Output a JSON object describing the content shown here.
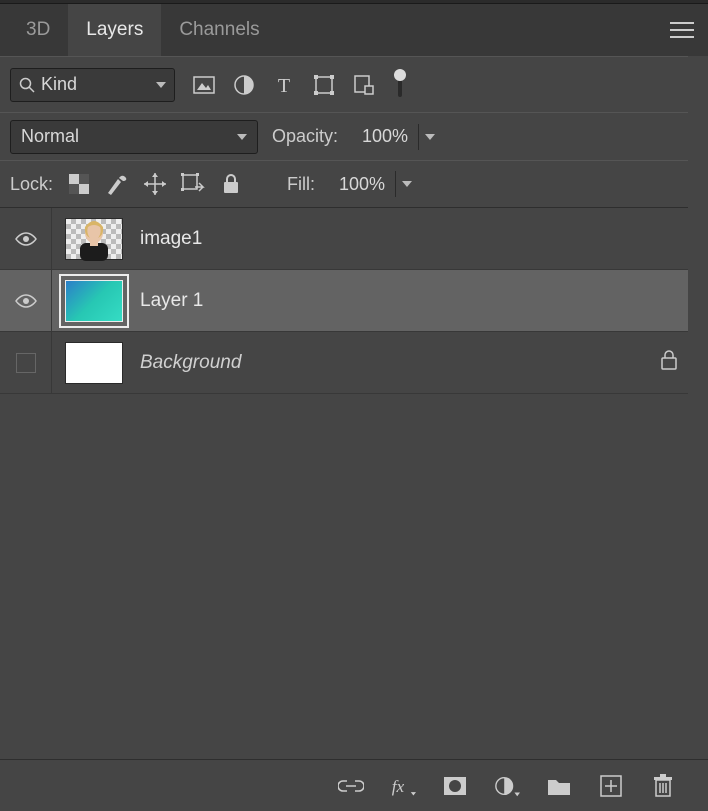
{
  "tabs": {
    "items": [
      {
        "label": "3D"
      },
      {
        "label": "Layers"
      },
      {
        "label": "Channels"
      }
    ],
    "active_index": 1
  },
  "filter": {
    "kind_label": "Kind"
  },
  "blend": {
    "mode": "Normal",
    "opacity_label": "Opacity:",
    "opacity_value": "100%"
  },
  "lock": {
    "label": "Lock:",
    "fill_label": "Fill:",
    "fill_value": "100%"
  },
  "layers": [
    {
      "name": "image1",
      "visible": true,
      "locked": false,
      "selected": false,
      "thumb": "person",
      "italic": false
    },
    {
      "name": "Layer 1",
      "visible": true,
      "locked": false,
      "selected": true,
      "thumb": "gradient",
      "italic": false
    },
    {
      "name": "Background",
      "visible": false,
      "locked": true,
      "selected": false,
      "thumb": "white",
      "italic": true
    }
  ]
}
